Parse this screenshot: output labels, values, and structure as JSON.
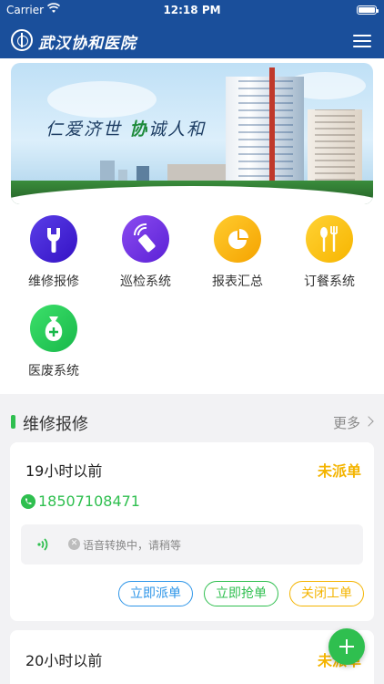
{
  "status_bar": {
    "carrier": "Carrier",
    "time": "12:18 PM"
  },
  "header": {
    "logo_text": "武汉协和医院"
  },
  "banner": {
    "slogan_prefix": "仁爱济世",
    "slogan_highlight": "协",
    "slogan_suffix": "诚人和"
  },
  "features": [
    {
      "label": "维修报修",
      "icon": "wrench-icon"
    },
    {
      "label": "巡检系统",
      "icon": "remote-control-icon"
    },
    {
      "label": "报表汇总",
      "icon": "pie-chart-icon"
    },
    {
      "label": "订餐系统",
      "icon": "fork-spoon-icon"
    },
    {
      "label": "医废系统",
      "icon": "medical-bag-icon"
    }
  ],
  "section": {
    "title": "维修报修",
    "more": "更多"
  },
  "orders": [
    {
      "time": "19小时以前",
      "status": "未派单",
      "phone": "18507108471",
      "voice_text": "语音转换中，请稍等",
      "buttons": {
        "dispatch": "立即派单",
        "grab": "立即抢单",
        "close": "关闭工单"
      }
    },
    {
      "time": "20小时以前",
      "status": "未派单"
    }
  ],
  "colors": {
    "header": "#1a4f9b",
    "accent_green": "#2fbf4f",
    "status_yellow": "#f4b400",
    "dispatch_blue": "#2d95e8"
  }
}
